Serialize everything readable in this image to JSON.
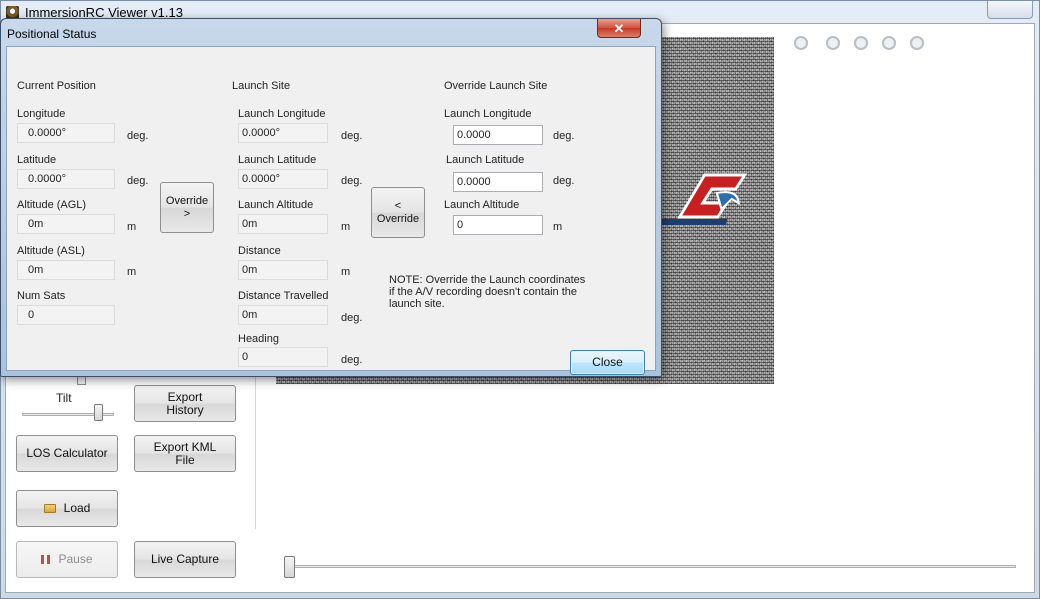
{
  "main_window": {
    "title": "ImmersionRC Viewer v1.13"
  },
  "left_panel": {
    "tilt_label": "Tilt",
    "export_history": "Export History",
    "los_calculator": "LOS Calculator",
    "export_kml": "Export KML File",
    "load": "Load",
    "pause": "Pause",
    "live_capture": "Live Capture"
  },
  "dialog": {
    "title": "Positional Status",
    "current_position": {
      "header": "Current Position",
      "longitude_label": "Longitude",
      "longitude_value": "0.0000°",
      "latitude_label": "Latitude",
      "latitude_value": "0.0000°",
      "altitude_agl_label": "Altitude (AGL)",
      "altitude_agl_value": "0m",
      "altitude_asl_label": "Altitude (ASL)",
      "altitude_asl_value": "0m",
      "num_sats_label": "Num Sats",
      "num_sats_value": "0"
    },
    "override_right_button": "Override >",
    "launch_site": {
      "header": "Launch Site",
      "longitude_label": "Launch Longitude",
      "longitude_value": "0.0000°",
      "latitude_label": "Launch Latitude",
      "latitude_value": "0.0000°",
      "altitude_label": "Launch Altitude",
      "altitude_value": "0m",
      "distance_label": "Distance",
      "distance_value": "0m",
      "distance_travelled_label": "Distance Travelled",
      "distance_travelled_value": "0m",
      "heading_label": "Heading",
      "heading_value": "0"
    },
    "override_left_button": "< Override",
    "override_launch_site": {
      "header": "Override Launch Site",
      "longitude_label": "Launch Longitude",
      "longitude_value": "0.0000",
      "latitude_label": "Launch Latitude",
      "latitude_value": "0.0000",
      "altitude_label": "Launch Altitude",
      "altitude_value": "0"
    },
    "units": {
      "deg": "deg.",
      "m": "m"
    },
    "note": "NOTE: Override the Launch coordinates if the A/V recording doesn't contain the launch site.",
    "close_button": "Close",
    "close_glyph": "✕"
  },
  "colors": {
    "dialog_close_red": "#c43b26",
    "default_button_blue": "#3c7fb1"
  }
}
